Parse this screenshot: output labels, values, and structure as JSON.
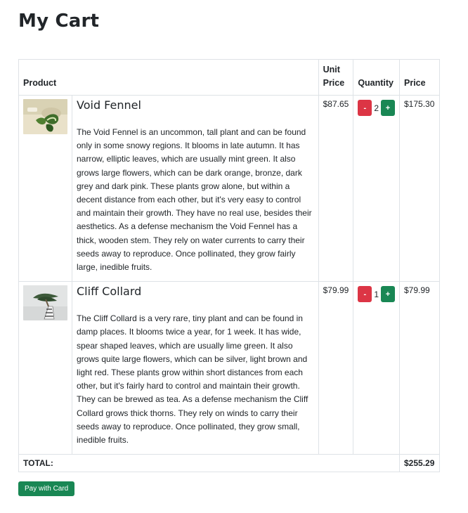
{
  "page": {
    "title": "My Cart"
  },
  "table": {
    "headers": {
      "product": "Product",
      "unit_price": "Unit Price",
      "quantity": "Quantity",
      "price": "Price"
    },
    "minus_label": "-",
    "plus_label": "+",
    "rows": [
      {
        "name": "Void Fennel",
        "description": "The Void Fennel is an uncommon, tall plant and can be found only in some snowy regions. It blooms in late autumn. It has narrow, elliptic leaves, which are usually mint green. It also grows large flowers, which can be dark orange, bronze, dark grey and dark pink. These plants grow alone, but within a decent distance from each other, but it's very easy to control and maintain their growth. They have no real use, besides their aesthetics. As a defense mechanism the Void Fennel has a thick, wooden stem. They rely on water currents to carry their seeds away to reproduce. Once pollinated, they grow fairly large, inedible fruits.",
        "unit_price": "$87.65",
        "quantity": "2",
        "price": "$175.30"
      },
      {
        "name": "Cliff Collard",
        "description": "The Cliff Collard is a very rare, tiny plant and can be found in damp places. It blooms twice a year, for 1 week. It has wide, spear shaped leaves, which are usually lime green. It also grows quite large flowers, which can be silver, light brown and light red. These plants grow within short distances from each other, but it's fairly hard to control and maintain their growth. They can be brewed as tea. As a defense mechanism the Cliff Collard grows thick thorns. They rely on winds to carry their seeds away to reproduce. Once pollinated, they grow small, inedible fruits.",
        "unit_price": "$79.99",
        "quantity": "1",
        "price": "$79.99"
      }
    ],
    "total_label": "TOTAL:",
    "total_value": "$255.29"
  },
  "actions": {
    "pay_label": "Pay with Card"
  },
  "colors": {
    "minus": "#dc3545",
    "plus": "#198754",
    "pay": "#198754"
  }
}
